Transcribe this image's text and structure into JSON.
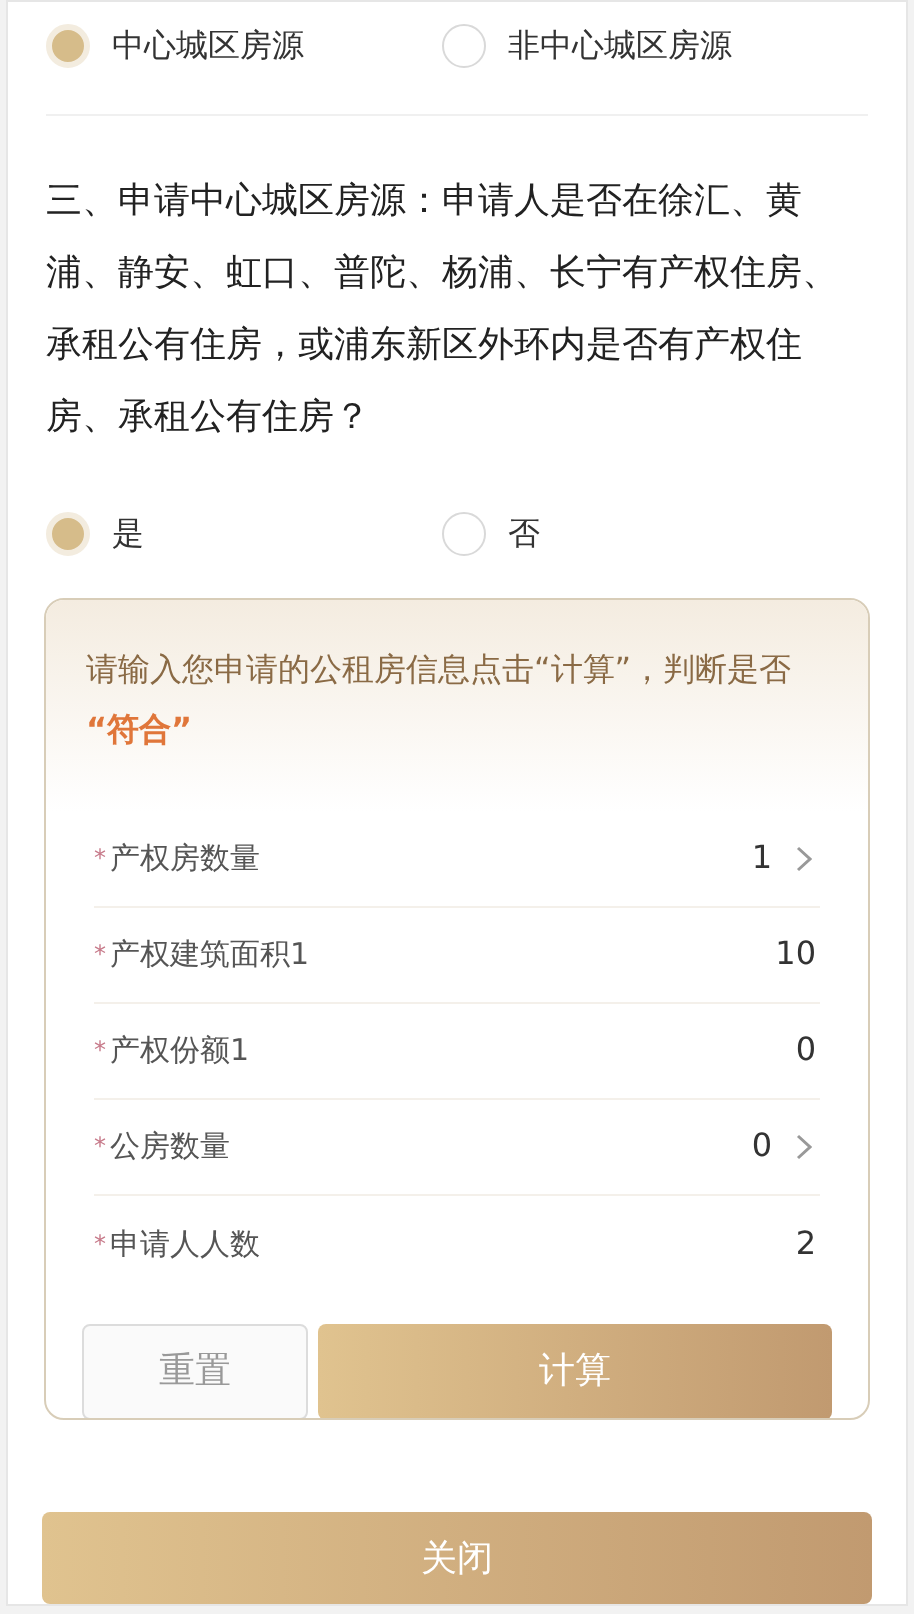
{
  "source_options": [
    {
      "label": "中心城区房源",
      "selected": true
    },
    {
      "label": "非中心城区房源",
      "selected": false
    }
  ],
  "question": "三、申请中心城区房源：申请人是否在徐汇、黄浦、静安、虹口、普陀、杨浦、长宁有产权住房、承租公有住房，或浦东新区外环内是否有产权住房、承租公有住房？",
  "answer_options": [
    {
      "label": "是",
      "selected": true
    },
    {
      "label": "否",
      "selected": false
    }
  ],
  "card": {
    "instruction": "请输入您申请的公租房信息点击“计算”，判断是否 **“符合”**",
    "fields": [
      {
        "mark": "*",
        "label": "产权房数量",
        "value": "1",
        "kind": "select"
      },
      {
        "mark": "*",
        "label": "产权建筑面积1",
        "value": "10",
        "kind": "input"
      },
      {
        "mark": "*",
        "label": "产权份额1",
        "value": "0",
        "kind": "input"
      },
      {
        "mark": "*",
        "label": "公房数量",
        "value": "0",
        "kind": "select"
      },
      {
        "mark": "*",
        "label": "申请人人数",
        "value": "2",
        "kind": "input"
      }
    ],
    "reset_button": "重置",
    "calculate_button": "计算"
  },
  "close_button": "关闭"
}
